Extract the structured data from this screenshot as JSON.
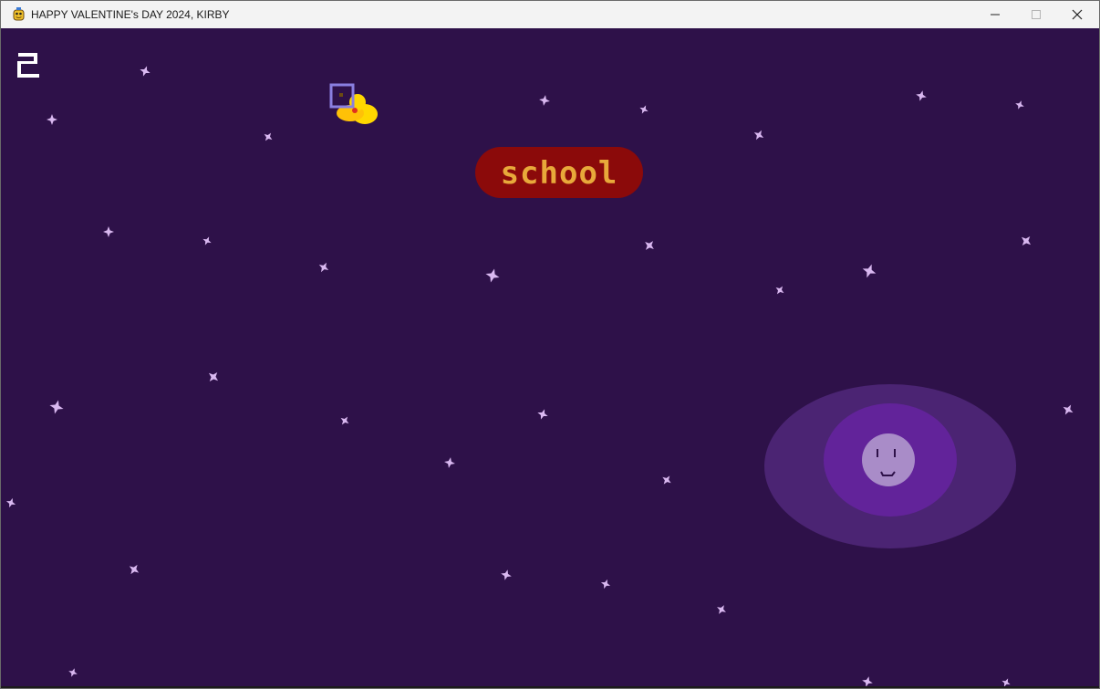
{
  "window": {
    "title": "HAPPY VALENTINE's DAY 2024, KIRBY",
    "icon": "pygame-snake-icon",
    "controls": [
      "minimize-icon",
      "maximize-icon",
      "close-icon"
    ]
  },
  "hud": {
    "score": "2"
  },
  "word": {
    "label": "school",
    "pill_color": "#8b0a0a",
    "text_color": "#e8a93a"
  },
  "colors": {
    "background": "#2e1149",
    "star": "#d9b8f0",
    "portal_outer": "#4b2473",
    "portal_inner": "#62239a",
    "face": "#a98cc8",
    "cursor": "#8a7fe0",
    "duck": "#ffd700"
  },
  "sprites": {
    "player": "yellow-duck",
    "portal": "smiling-moon-portal",
    "stars": "sparkle-stars"
  }
}
